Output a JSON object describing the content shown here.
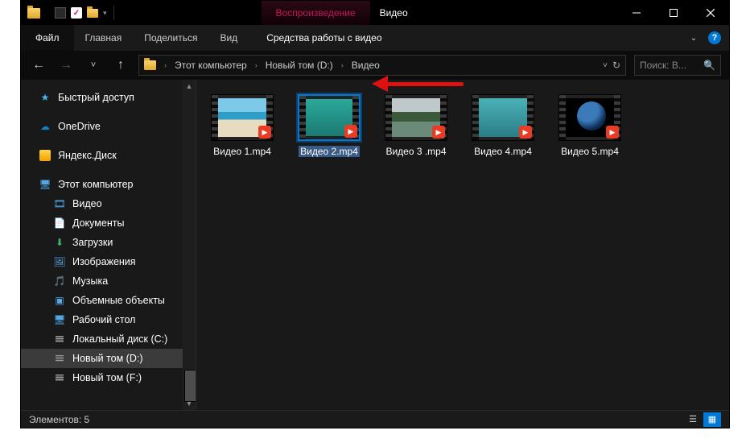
{
  "title_context_label": "Воспроизведение",
  "title_window": "Видео",
  "ribbon": {
    "file": "Файл",
    "home": "Главная",
    "share": "Поделиться",
    "view": "Вид",
    "ctx": "Средства работы с видео"
  },
  "breadcrumb": {
    "items": [
      "Этот компьютер",
      "Новый том (D:)",
      "Видео"
    ]
  },
  "search_placeholder": "Поиск: В...",
  "sidebar": {
    "quick": "Быстрый доступ",
    "onedrive": "OneDrive",
    "yandex": "Яндекс.Диск",
    "this_pc": "Этот компьютер",
    "videos": "Видео",
    "documents": "Документы",
    "downloads": "Загрузки",
    "pictures": "Изображения",
    "music": "Музыка",
    "objects3d": "Объемные объекты",
    "desktop": "Рабочий стол",
    "diskC": "Локальный диск (C:)",
    "diskD": "Новый том (D:)",
    "diskF": "Новый том (F:)"
  },
  "files": [
    {
      "name": "Видео 1.mp4",
      "selected": false,
      "pic": "beach"
    },
    {
      "name": "Видео 2.mp4",
      "selected": true,
      "pic": "sea"
    },
    {
      "name": "Видео 3 .mp4",
      "selected": false,
      "pic": "cliff"
    },
    {
      "name": "Видео 4.mp4",
      "selected": false,
      "pic": "ocean"
    },
    {
      "name": "Видео 5.mp4",
      "selected": false,
      "pic": "earth"
    }
  ],
  "status": {
    "count_label": "Элементов: 5"
  }
}
